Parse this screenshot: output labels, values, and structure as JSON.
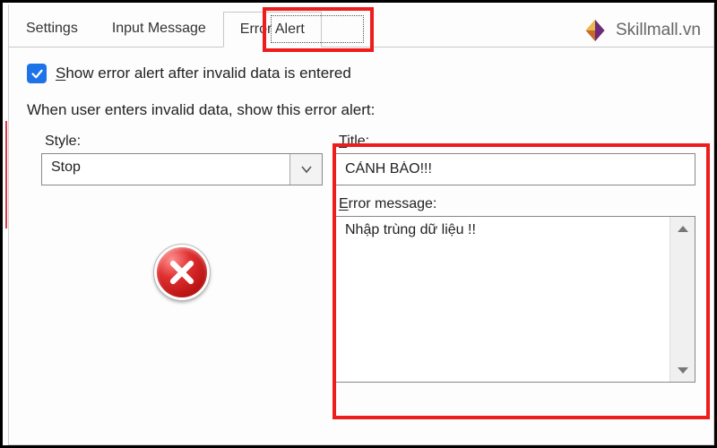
{
  "tabs": {
    "settings": "Settings",
    "input_message": "Input Message",
    "error_alert": "Error Alert"
  },
  "checkbox": {
    "checked": true,
    "prefix": "S",
    "rest": "how error alert after invalid data is entered"
  },
  "section_heading": "When user enters invalid data, show this error alert:",
  "style": {
    "label": "Style:",
    "value": "Stop"
  },
  "title_field": {
    "label_prefix": "T",
    "label_rest": "itle:",
    "value": "CẢNH BÁO!!!"
  },
  "error_message_field": {
    "label_prefix": "E",
    "label_rest": "rror message:",
    "value": "Nhập trùng dữ liệu !!"
  },
  "brand": {
    "text": "Skillmall.vn"
  }
}
